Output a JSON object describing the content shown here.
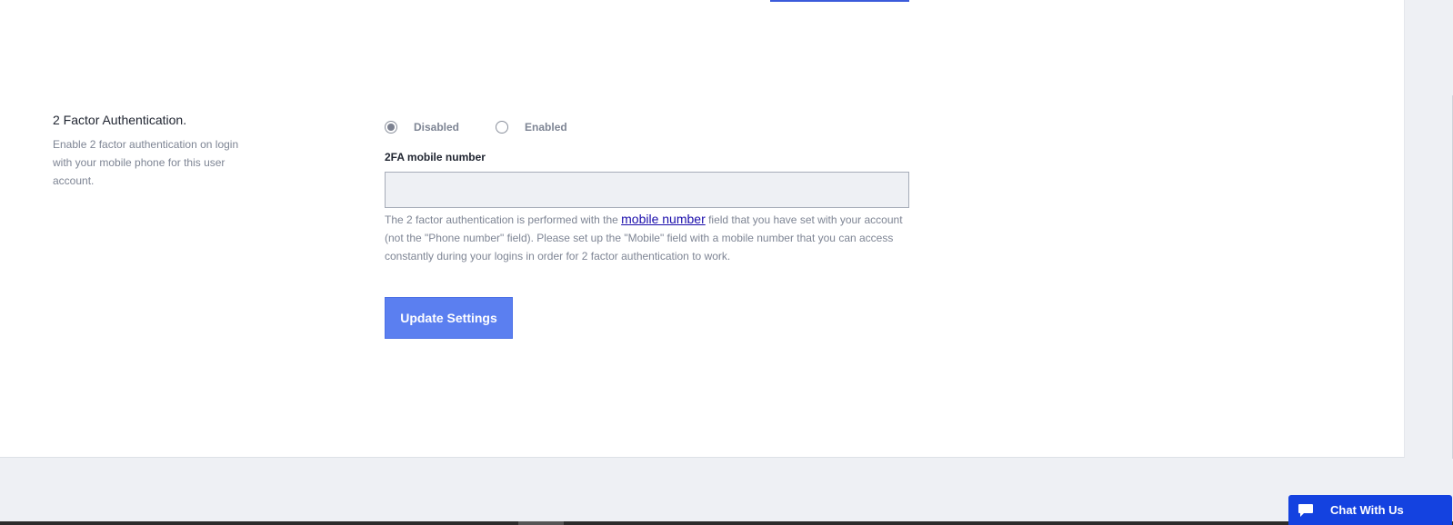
{
  "two_factor": {
    "title": "2 Factor Authentication.",
    "description": "Enable 2 factor authentication on login with your mobile phone for this user account.",
    "options": [
      {
        "label": "Disabled",
        "selected": true
      },
      {
        "label": "Enabled",
        "selected": false
      }
    ],
    "mobile_field": {
      "label": "2FA mobile number",
      "value": "",
      "placeholder": ""
    },
    "help": {
      "before_link": "The 2 factor authentication is performed with the ",
      "link_text": "mobile number",
      "after_link": " field that you have set with your account (not the \"Phone number\" field). Please set up the \"Mobile\" field with a mobile number that you can access constantly during your logins in order for 2 factor authentication to work."
    },
    "submit_label": "Update Settings"
  },
  "chat": {
    "label": "Chat With Us"
  },
  "colors": {
    "primary_button": "#5b7ff0",
    "chat_button": "#1442e0",
    "link": "#1a0dab"
  },
  "icons": {
    "chat": "chat-bubble-icon"
  }
}
